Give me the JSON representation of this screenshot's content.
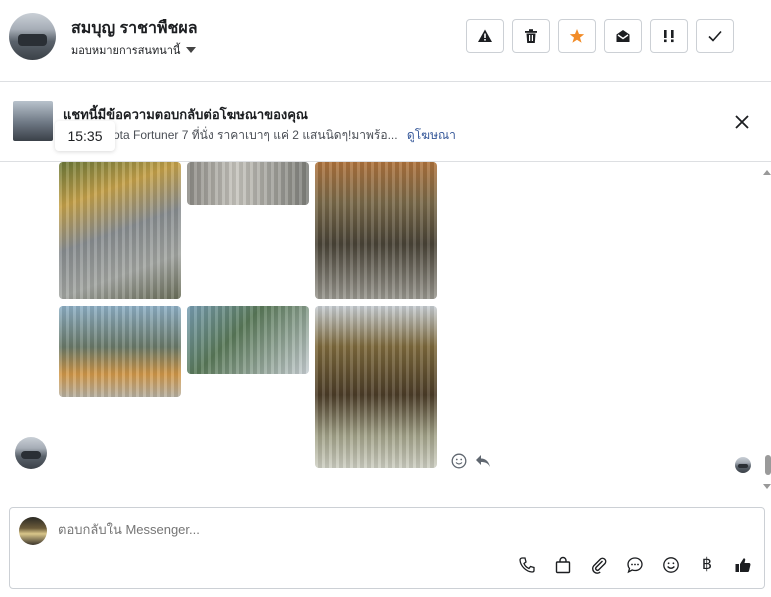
{
  "header": {
    "contact_name": "สมบุญ ราชาพืชผล",
    "assign_label": "มอบหมายการสนทนานี้",
    "actions": [
      {
        "icon": "warning-icon"
      },
      {
        "icon": "trash-icon"
      },
      {
        "icon": "star-icon",
        "color": "#f28c28"
      },
      {
        "icon": "envelope-open-icon"
      },
      {
        "icon": "exclamation-icon"
      },
      {
        "icon": "check-icon"
      }
    ]
  },
  "ad_banner": {
    "title": "แชทนี้มีข้อความตอบกลับต่อโฆษณาของคุณ",
    "description": "ลังเล! Toyota Fortuner 7 ที่นั่ง ราคาเบาๆ แค่ 2 แสนนิดๆ!มาพร้อ...",
    "link_label": "ดูโฆษณา",
    "tooltip_time": "15:35"
  },
  "conversation": {
    "photos": [
      "photo-1",
      "photo-2",
      "photo-3",
      "photo-4",
      "photo-5",
      "photo-6"
    ]
  },
  "composer": {
    "placeholder": "ตอบกลับใน Messenger...",
    "tools": [
      "phone-icon",
      "shopping-bag-icon",
      "paperclip-icon",
      "chat-bubble-icon",
      "smiley-icon"
    ],
    "currency_symbol": "฿",
    "like_icon": "thumbs-up-icon"
  },
  "colors": {
    "accent_link": "#365899",
    "star": "#f28c28",
    "border": "#dddfe2"
  }
}
